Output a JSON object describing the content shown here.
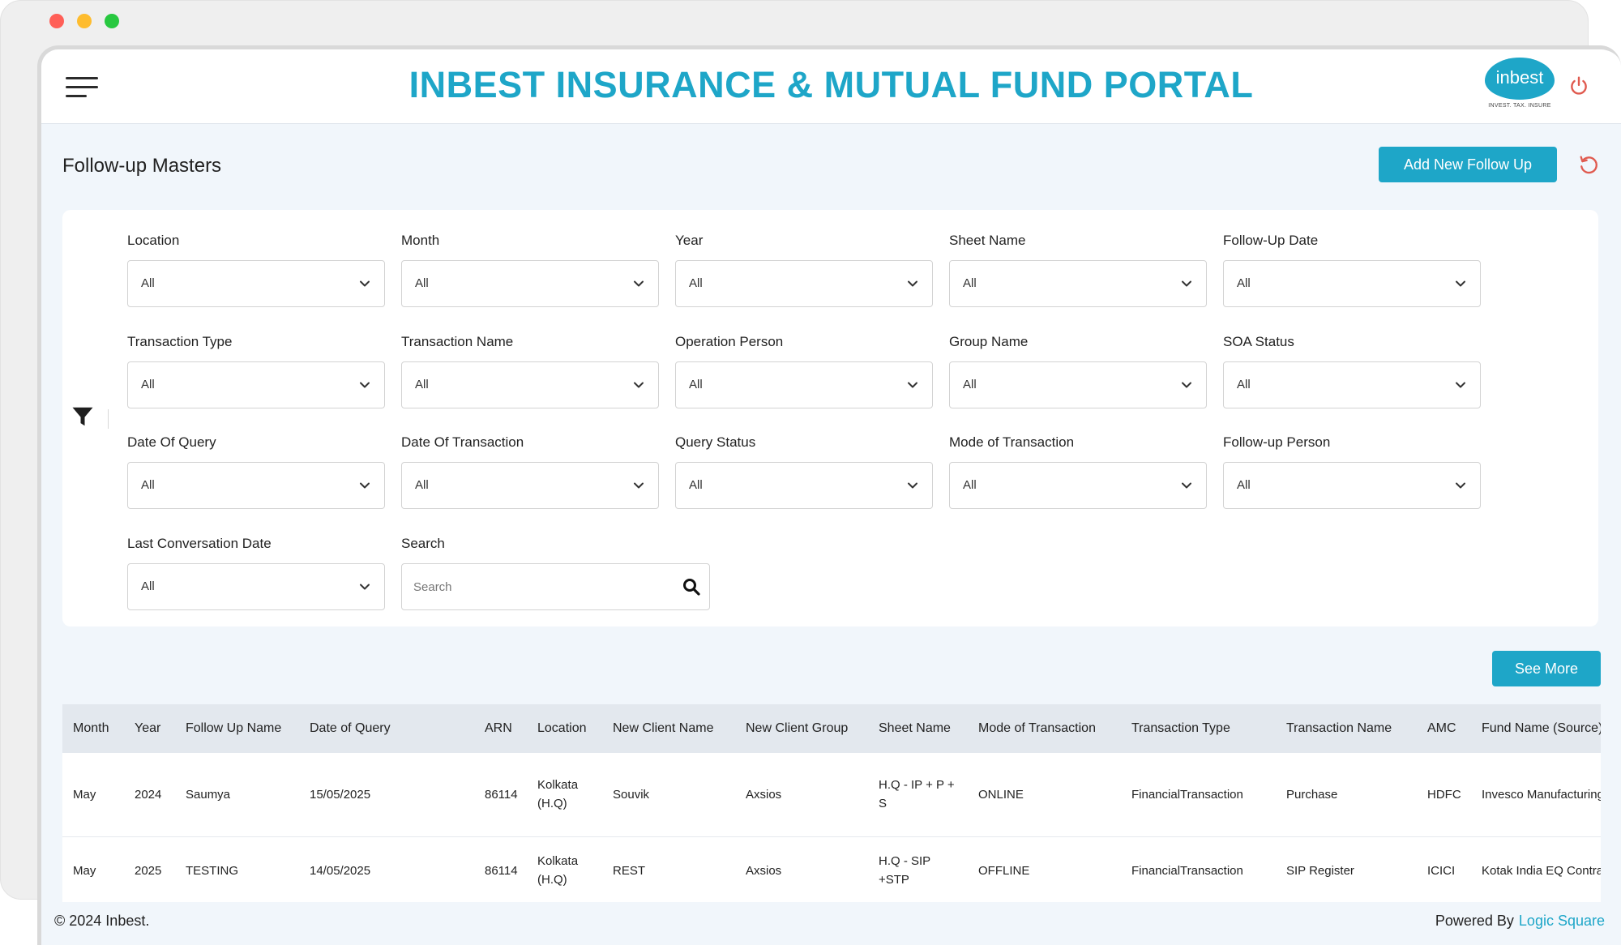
{
  "header": {
    "title": "INBEST INSURANCE & MUTUAL FUND PORTAL",
    "logo_text": "inbest",
    "logo_tagline": "INVEST. TAX. INSURE",
    "accent_color": "#1ea6c8",
    "power_color": "#e05a4f"
  },
  "page": {
    "title": "Follow-up Masters",
    "add_button": "Add New Follow Up",
    "see_more": "See More"
  },
  "filters": {
    "location": {
      "label": "Location",
      "value": "All"
    },
    "month": {
      "label": "Month",
      "value": "All"
    },
    "year": {
      "label": "Year",
      "value": "All"
    },
    "sheet_name": {
      "label": "Sheet Name",
      "value": "All"
    },
    "follow_up_date": {
      "label": "Follow-Up Date",
      "value": "All"
    },
    "transaction_type": {
      "label": "Transaction Type",
      "value": "All"
    },
    "transaction_name": {
      "label": "Transaction Name",
      "value": "All"
    },
    "operation_person": {
      "label": "Operation Person",
      "value": "All"
    },
    "group_name": {
      "label": "Group Name",
      "value": "All"
    },
    "soa_status": {
      "label": "SOA Status",
      "value": "All"
    },
    "date_of_query": {
      "label": "Date Of Query",
      "value": "All"
    },
    "date_of_transaction": {
      "label": "Date Of Transaction",
      "value": "All"
    },
    "query_status": {
      "label": "Query Status",
      "value": "All"
    },
    "mode_of_transaction": {
      "label": "Mode of Transaction",
      "value": "All"
    },
    "follow_up_person": {
      "label": "Follow-up Person",
      "value": "All"
    },
    "last_conversation_date": {
      "label": "Last Conversation Date",
      "value": "All"
    },
    "search": {
      "label": "Search",
      "placeholder": "Search",
      "value": ""
    }
  },
  "table": {
    "columns": [
      "Month",
      "Year",
      "Follow Up Name",
      "Date of Query",
      "ARN",
      "Location",
      "New Client Name",
      "New Client Group",
      "Sheet Name",
      "Mode of Transaction",
      "Transaction Type",
      "Transaction Name",
      "AMC",
      "Fund Name (Source)"
    ],
    "rows": [
      [
        "May",
        "2024",
        "Saumya",
        "15/05/2025",
        "86114",
        "Kolkata (H.Q)",
        "Souvik",
        "Axsios",
        "H.Q - IP + P + S",
        "ONLINE",
        "FinancialTransaction",
        "Purchase",
        "HDFC",
        "Invesco Manufacturing Fund-G"
      ],
      [
        "May",
        "2025",
        "TESTING",
        "14/05/2025",
        "86114",
        "Kolkata (H.Q)",
        "REST",
        "Axsios",
        "H.Q - SIP +STP",
        "OFFLINE",
        "FinancialTransaction",
        "SIP Register",
        "ICICI",
        "Kotak India EQ Contra-G"
      ]
    ]
  },
  "footer": {
    "copyright": "© 2024 Inbest.",
    "powered_by": "Powered By",
    "powered_brand": "Logic Square"
  }
}
